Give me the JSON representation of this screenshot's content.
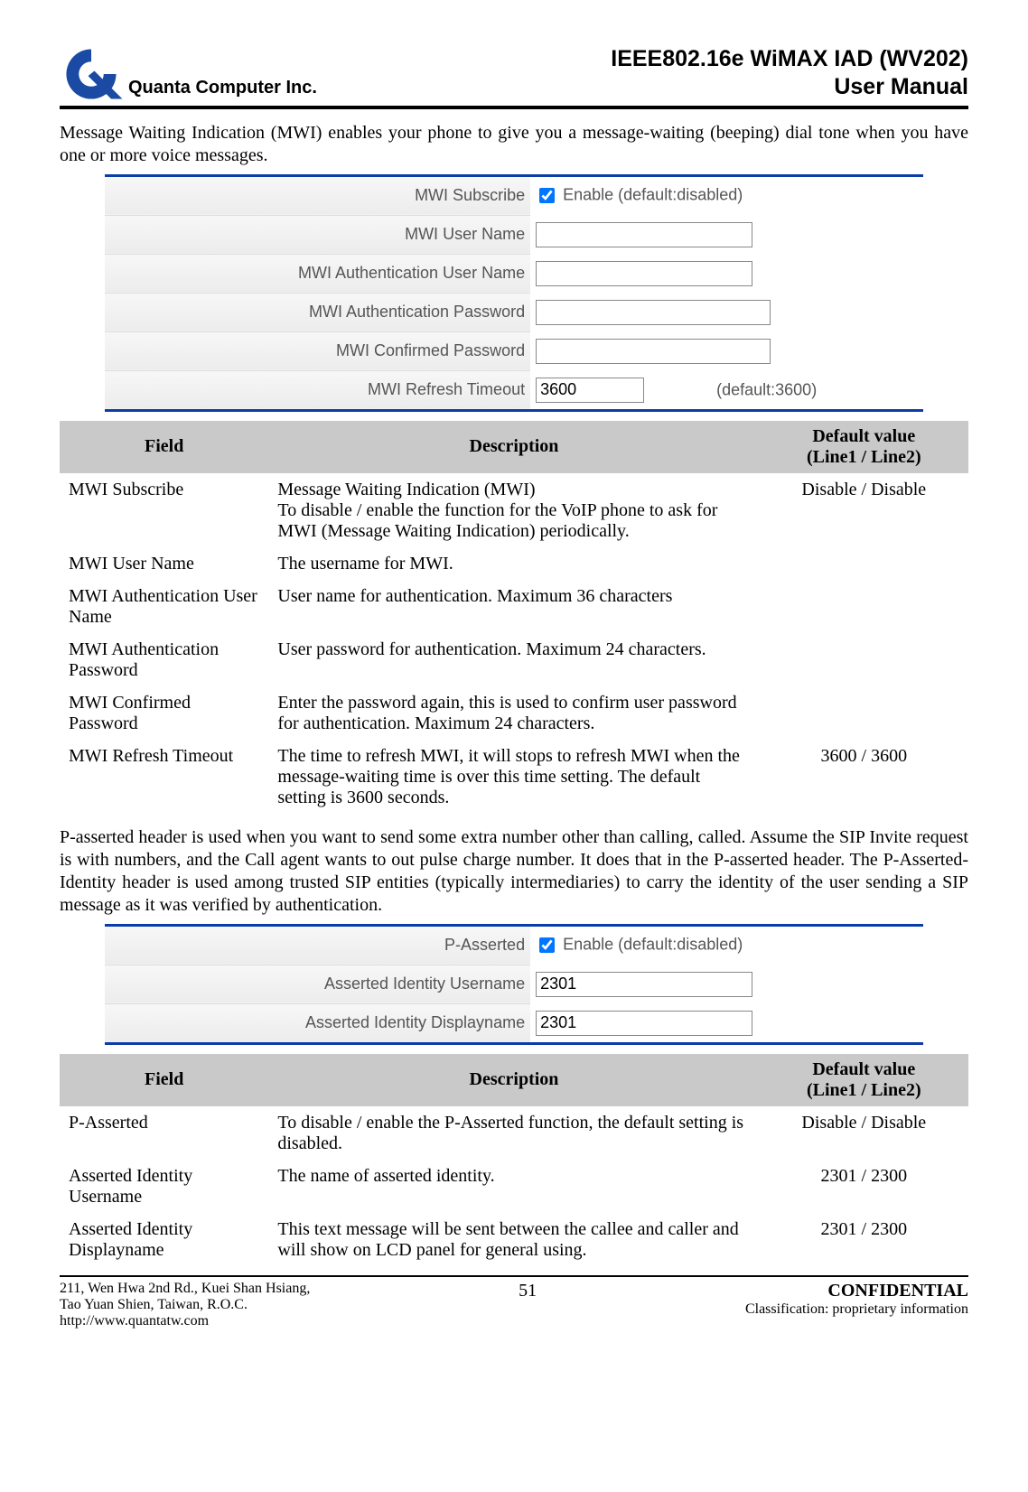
{
  "header": {
    "company": "Quanta  Computer  Inc.",
    "title_line1": "IEEE802.16e  WiMAX  IAD  (WV202)",
    "title_line2": "User  Manual"
  },
  "intro_mwi": "Message Waiting Indication (MWI) enables your phone to give you a message-waiting (beeping) dial tone when you have one or more voice messages.",
  "mwi_form": {
    "subscribe_label": "MWI Subscribe",
    "subscribe_text": "Enable (default:disabled)",
    "user_name_label": "MWI User Name",
    "auth_user_label": "MWI Authentication User Name",
    "auth_pass_label": "MWI Authentication Password",
    "conf_pass_label": "MWI Confirmed Password",
    "refresh_label": "MWI Refresh Timeout",
    "refresh_value": "3600",
    "refresh_hint": "(default:3600)"
  },
  "table_headers": {
    "field": "Field",
    "description": "Description",
    "default": "Default value\n(Line1 / Line2)"
  },
  "mwi_table": [
    {
      "field": "MWI Subscribe",
      "desc": "Message Waiting Indication (MWI)\nTo disable / enable the function for the VoIP phone to ask for MWI (Message Waiting Indication) periodically.",
      "def": "Disable / Disable"
    },
    {
      "field": "MWI User Name",
      "desc": "The username for MWI.",
      "def": ""
    },
    {
      "field": "MWI Authentication User Name",
      "desc": "User name for authentication. Maximum 36 characters",
      "def": ""
    },
    {
      "field": "MWI Authentication Password",
      "desc": "User password for authentication. Maximum 24 characters.",
      "def": ""
    },
    {
      "field": "MWI Confirmed Password",
      "desc": "Enter the password again, this is used to confirm user password for authentication. Maximum 24 characters.",
      "def": ""
    },
    {
      "field": "MWI Refresh Timeout",
      "desc": "The time to refresh MWI, it will stops to refresh MWI when the message-waiting time is over this time setting. The default setting is 3600 seconds.",
      "def": "3600 / 3600"
    }
  ],
  "intro_passerted": "P-asserted header is used when you want to send some extra number other than calling, called. Assume the SIP Invite request is with numbers, and the Call agent wants to out pulse charge number. It does that in the P-asserted header. The P-Asserted-Identity header is used among trusted SIP entities (typically intermediaries) to carry the identity of the user sending a SIP message as it was verified by authentication.",
  "pa_form": {
    "pa_label": "P-Asserted",
    "pa_text": "Enable (default:disabled)",
    "username_label": "Asserted Identity Username",
    "username_value": "2301",
    "displayname_label": "Asserted Identity Displayname",
    "displayname_value": "2301"
  },
  "pa_table": [
    {
      "field": "P-Asserted",
      "desc": "To disable / enable the P-Asserted function, the default setting is disabled.",
      "def": "Disable / Disable"
    },
    {
      "field": "Asserted Identity Username",
      "desc": "The name of asserted identity.",
      "def": "2301 / 2300"
    },
    {
      "field": "Asserted Identity Displayname",
      "desc": "This text message will be sent between the callee and caller and will show on LCD panel for general using.",
      "def": "2301 / 2300"
    }
  ],
  "footer": {
    "addr1": "211, Wen Hwa 2nd Rd., Kuei Shan Hsiang,",
    "addr2": "Tao Yuan Shien, Taiwan, R.O.C.",
    "addr3": "http://www.quantatw.com",
    "page": "51",
    "conf": "CONFIDENTIAL",
    "class": "Classification: proprietary information"
  }
}
